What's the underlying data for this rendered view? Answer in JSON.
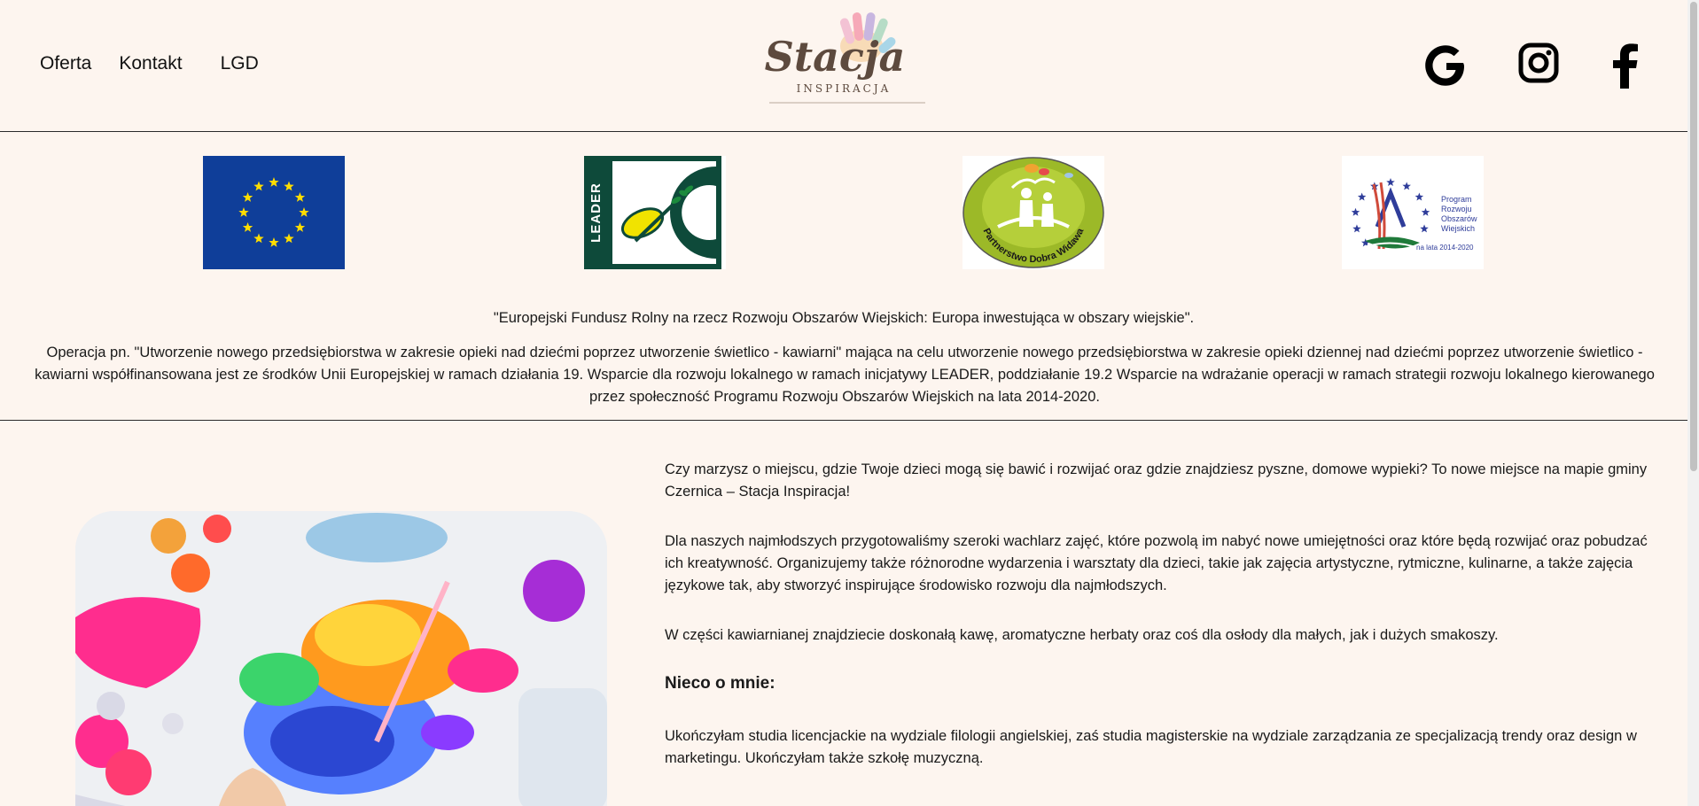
{
  "nav": {
    "oferta": "Oferta",
    "kontakt": "Kontakt",
    "lgd": "LGD"
  },
  "logo": {
    "name": "Stacja",
    "sub": "INSPIRACJA"
  },
  "social": {
    "google": "google-icon",
    "instagram": "instagram-icon",
    "facebook": "facebook-icon"
  },
  "logos": {
    "leader": "LEADER",
    "pdw": "Partnerstwo Dobra Widawa",
    "prow_line1": "Program",
    "prow_line2": "Rozwoju",
    "prow_line3": "Obszarów",
    "prow_line4": "Wiejskich",
    "prow_line5": "na lata 2014-2020"
  },
  "funding": {
    "quote": "\"Europejski Fundusz Rolny na rzecz Rozwoju Obszarów Wiejskich: Europa inwestująca w obszary wiejskie\".",
    "text": "Operacja pn. \"Utworzenie nowego przedsiębiorstwa w zakresie opieki nad dziećmi poprzez utworzenie świetlico - kawiarni\" mająca na celu utworzenie nowego przedsiębiorstwa w zakresie opieki dziennej nad dziećmi poprzez utworzenie świetlico - kawiarni współfinansowana jest ze środków Unii Europejskiej w ramach działania 19. Wsparcie dla rozwoju lokalnego w ramach inicjatywy LEADER, poddziałanie 19.2 Wsparcie na wdrażanie operacji w ramach strategii rozwoju lokalnego kierowanego przez społeczność Programu Rozwoju Obszarów Wiejskich na lata 2014-2020."
  },
  "content": {
    "p1": "Czy marzysz o miejscu, gdzie Twoje dzieci mogą się bawić i rozwijać oraz gdzie znajdziesz pyszne, domowe wypieki? To nowe miejsce na mapie gminy Czernica – Stacja Inspiracja!",
    "p2": "Dla naszych najmłodszych przygotowaliśmy szeroki wachlarz zajęć, które pozwolą im nabyć nowe umiejętności oraz które będą rozwijać oraz pobudzać ich kreatywność. Organizujemy także różnorodne wydarzenia i warsztaty dla dzieci, takie jak zajęcia artystyczne, rytmiczne, kulinarne, a także zajęcia językowe tak, aby stworzyć inspirujące środowisko rozwoju dla najmłodszych.",
    "p3": "W części kawiarnianej znajdziecie doskonałą kawę, aromatyczne herbaty oraz coś dla osłody dla małych, jak i dużych smakoszy.",
    "heading": "Nieco o mnie:",
    "p4": "Ukończyłam studia licencjackie na wydziale filologii angielskiej, zaś studia magisterskie na wydziale zarządzania ze specjalizacją trendy oraz design w marketingu. Ukończyłam także szkołę muzyczną."
  },
  "colors": {
    "background": "#fdf5ef",
    "eu_blue": "#0f3e99",
    "eu_star": "#ffdd00",
    "leader_green": "#0e4a3a",
    "pdw_green": "#9cb928"
  }
}
